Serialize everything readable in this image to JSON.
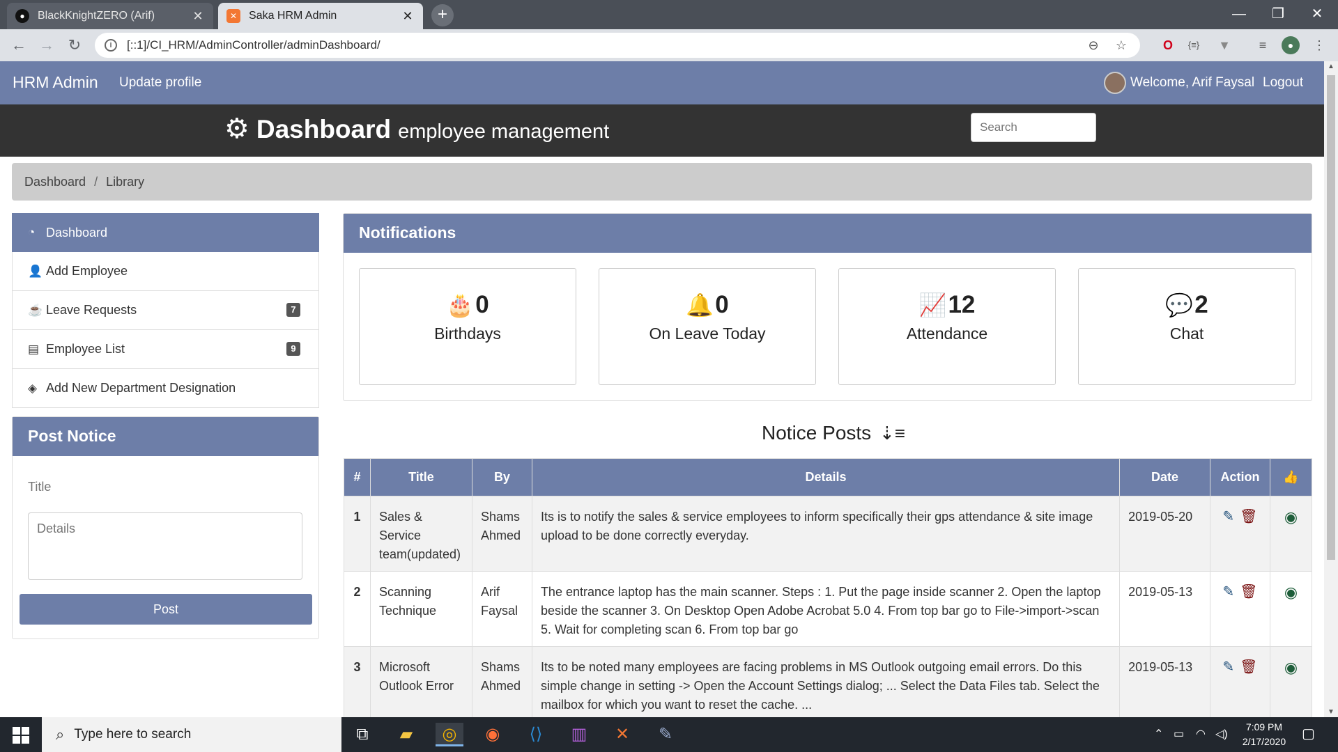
{
  "browser": {
    "tabs": [
      {
        "title": "BlackKnightZERO (Arif)",
        "favicon": "github-icon"
      },
      {
        "title": "Saka HRM Admin",
        "favicon": "xampp-icon"
      }
    ],
    "close_glyph": "✕",
    "new_tab_glyph": "+",
    "url": "[::1]/CI_HRM/AdminController/adminDashboard/"
  },
  "topnav": {
    "brand": "HRM Admin",
    "update_profile": "Update profile",
    "welcome": "Welcome, Arif Faysal",
    "logout": "Logout"
  },
  "hero": {
    "title": "Dashboard",
    "subtitle": "employee management",
    "search_placeholder": "Search"
  },
  "breadcrumb": {
    "items": [
      "Dashboard",
      "Library"
    ],
    "separator": "/"
  },
  "sidebar": {
    "items": [
      {
        "label": "Dashboard",
        "icon": "dashboard-icon"
      },
      {
        "label": "Add Employee",
        "icon": "user-icon"
      },
      {
        "label": "Leave Requests",
        "icon": "coffee-icon",
        "badge": "7"
      },
      {
        "label": "Employee List",
        "icon": "list-icon",
        "badge": "9"
      },
      {
        "label": "Add New Department Designation",
        "icon": "layers-icon"
      }
    ]
  },
  "post_notice": {
    "header": "Post Notice",
    "title_placeholder": "Title",
    "details_placeholder": "Details",
    "button": "Post"
  },
  "notifications": {
    "header": "Notifications",
    "stats": [
      {
        "value": "0",
        "label": "Birthdays",
        "icon": "birthday-cake-icon"
      },
      {
        "value": "0",
        "label": "On Leave Today",
        "icon": "bell-icon"
      },
      {
        "value": "12",
        "label": "Attendance",
        "icon": "chart-line-icon"
      },
      {
        "value": "2",
        "label": "Chat",
        "icon": "comment-icon"
      }
    ]
  },
  "notice_posts": {
    "title": "Notice Posts",
    "columns": [
      "#",
      "Title",
      "By",
      "Details",
      "Date",
      "Action"
    ],
    "rows": [
      {
        "num": "1",
        "title": "Sales & Service team(updated)",
        "by": "Shams Ahmed",
        "details": "Its is to notify the sales & service employees to inform specifically their gps attendance & site image upload to be done correctly everyday.",
        "date": "2019-05-20"
      },
      {
        "num": "2",
        "title": "Scanning Technique",
        "by": "Arif Faysal",
        "details": "The entrance laptop has the main scanner. Steps : 1. Put the page inside scanner 2. Open the laptop beside the scanner 3. On Desktop Open Adobe Acrobat 5.0 4. From top bar go to File->import->scan 5. Wait for completing scan 6. From top bar go",
        "date": "2019-05-13"
      },
      {
        "num": "3",
        "title": "Microsoft Outlook Error",
        "by": "Shams Ahmed",
        "details": "Its to be noted many employees are facing problems in MS Outlook outgoing email errors. Do this simple change in setting -> Open the Account Settings dialog; ... Select the Data Files tab. Select the mailbox for which you want to reset the cache. ...",
        "date": "2019-05-13"
      }
    ]
  },
  "taskbar": {
    "search_placeholder": "Type here to search",
    "time": "7:09 PM",
    "date": "2/17/2020"
  },
  "colors": {
    "primary": "#6d7ea8",
    "hero_bg": "#333333",
    "breadcrumb_bg": "#cccccc"
  }
}
